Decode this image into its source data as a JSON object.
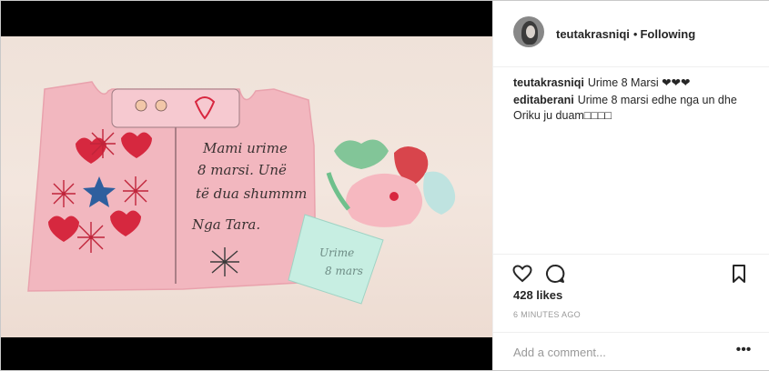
{
  "header": {
    "username": "teutakrasniqi",
    "separator": "•",
    "follow_status": "Following"
  },
  "comments": [
    {
      "user": "teutakrasniqi",
      "text": "Urime 8 Marsi ❤❤❤"
    },
    {
      "user": "editaberani",
      "text": "Urime 8 marsi edhe nga un dhe Oriku ju duam□□□□"
    }
  ],
  "actions": {
    "like_icon": "heart-icon",
    "comment_icon": "comment-icon",
    "save_icon": "bookmark-icon"
  },
  "likes": "428 likes",
  "timestamp": "6 MINUTES AGO",
  "add_comment": {
    "placeholder": "Add a comment..."
  },
  "more_label": "•••",
  "photo": {
    "card_text": [
      "Mami urime",
      "8 marsi. Unë",
      "të dua shummm",
      "Nga Tara."
    ],
    "flower_text": [
      "Urime",
      "8 mars"
    ]
  },
  "colors": {
    "accent": "#262626",
    "muted": "#999999",
    "border": "#efefef"
  }
}
